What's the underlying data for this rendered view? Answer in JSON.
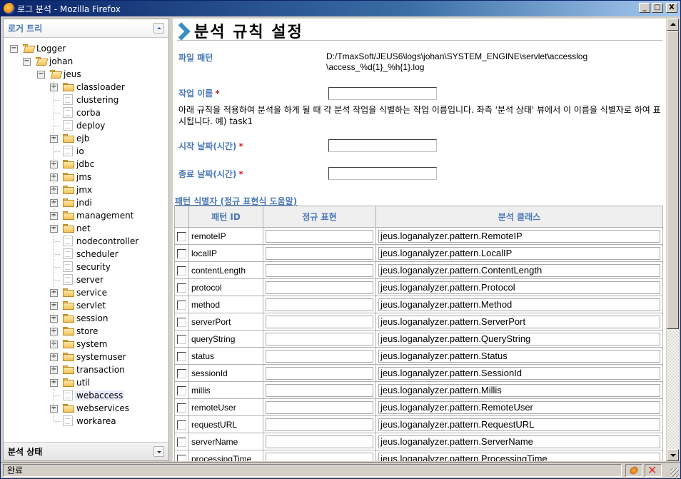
{
  "window": {
    "title": "로그 분석 - Mozilla Firefox",
    "buttons": {
      "minimize": "_",
      "maximize": "□",
      "close": "X"
    }
  },
  "sidebar": {
    "header": "로거 트리",
    "footer": "분석 상태",
    "tree": [
      {
        "label": "Logger",
        "type": "folder-open",
        "level": 0,
        "expander": "minus"
      },
      {
        "label": "johan",
        "type": "folder-open",
        "level": 1,
        "expander": "minus"
      },
      {
        "label": "jeus",
        "type": "folder-open",
        "level": 2,
        "expander": "minus"
      },
      {
        "label": "classloader",
        "type": "folder",
        "level": 3,
        "expander": "plus"
      },
      {
        "label": "clustering",
        "type": "doc",
        "level": 3
      },
      {
        "label": "corba",
        "type": "doc",
        "level": 3
      },
      {
        "label": "deploy",
        "type": "doc",
        "level": 3
      },
      {
        "label": "ejb",
        "type": "folder",
        "level": 3,
        "expander": "plus"
      },
      {
        "label": "io",
        "type": "doc",
        "level": 3
      },
      {
        "label": "jdbc",
        "type": "folder",
        "level": 3,
        "expander": "plus"
      },
      {
        "label": "jms",
        "type": "folder",
        "level": 3,
        "expander": "plus"
      },
      {
        "label": "jmx",
        "type": "folder",
        "level": 3,
        "expander": "plus"
      },
      {
        "label": "jndi",
        "type": "folder",
        "level": 3,
        "expander": "plus"
      },
      {
        "label": "management",
        "type": "folder",
        "level": 3,
        "expander": "plus"
      },
      {
        "label": "net",
        "type": "folder",
        "level": 3,
        "expander": "plus"
      },
      {
        "label": "nodecontroller",
        "type": "doc",
        "level": 3
      },
      {
        "label": "scheduler",
        "type": "doc",
        "level": 3
      },
      {
        "label": "security",
        "type": "doc",
        "level": 3
      },
      {
        "label": "server",
        "type": "doc",
        "level": 3
      },
      {
        "label": "service",
        "type": "folder",
        "level": 3,
        "expander": "plus"
      },
      {
        "label": "servlet",
        "type": "folder",
        "level": 3,
        "expander": "plus"
      },
      {
        "label": "session",
        "type": "folder",
        "level": 3,
        "expander": "plus"
      },
      {
        "label": "store",
        "type": "folder",
        "level": 3,
        "expander": "plus"
      },
      {
        "label": "system",
        "type": "folder",
        "level": 3,
        "expander": "plus"
      },
      {
        "label": "systemuser",
        "type": "folder",
        "level": 3,
        "expander": "plus"
      },
      {
        "label": "transaction",
        "type": "folder",
        "level": 3,
        "expander": "plus"
      },
      {
        "label": "util",
        "type": "folder",
        "level": 3,
        "expander": "plus"
      },
      {
        "label": "webaccess",
        "type": "doc",
        "level": 3,
        "selected": true
      },
      {
        "label": "webservices",
        "type": "folder",
        "level": 3,
        "expander": "plus"
      },
      {
        "label": "workarea",
        "type": "doc",
        "level": 3
      }
    ]
  },
  "main": {
    "title": "분석 규칙 설정",
    "file_pattern_label": "파일 패턴",
    "file_pattern_line1": "D:/TmaxSoft/JEUS6\\logs\\johan\\SYSTEM_ENGINE\\servlet\\accesslog",
    "file_pattern_line2": "\\access_%d{1}_%h{1}.log",
    "task_name_label": "작업 이름",
    "required_mark": "*",
    "task_name_value": "",
    "task_desc": "아래 규칙을 적용하여 분석을 하게 될 때 각 분석 작업을 식별하는 작업 이름입니다. 좌측 '분석 상태' 뷰에서 이 이름을 식별자로 하여 표시됩니다. 예) task1",
    "start_label": "시작 날짜(시간)",
    "start_value": "",
    "end_label": "종료 날짜(시간)",
    "end_value": "",
    "pattern_section": "패턴 식별자 (정규 표현식 도움말)",
    "table": {
      "headers": [
        "",
        "패턴 ID",
        "정규 표현",
        "분석 클래스"
      ],
      "rows": [
        {
          "id": "remoteIP",
          "regex": "",
          "cls": "jeus.loganalyzer.pattern.RemoteIP",
          "checked": false
        },
        {
          "id": "localIP",
          "regex": "",
          "cls": "jeus.loganalyzer.pattern.LocalIP",
          "checked": false
        },
        {
          "id": "contentLength",
          "regex": "",
          "cls": "jeus.loganalyzer.pattern.ContentLength",
          "checked": false
        },
        {
          "id": "protocol",
          "regex": "",
          "cls": "jeus.loganalyzer.pattern.Protocol",
          "checked": false
        },
        {
          "id": "method",
          "regex": "",
          "cls": "jeus.loganalyzer.pattern.Method",
          "checked": false
        },
        {
          "id": "serverPort",
          "regex": "",
          "cls": "jeus.loganalyzer.pattern.ServerPort",
          "checked": false
        },
        {
          "id": "queryString",
          "regex": "",
          "cls": "jeus.loganalyzer.pattern.QueryString",
          "checked": false
        },
        {
          "id": "status",
          "regex": "",
          "cls": "jeus.loganalyzer.pattern.Status",
          "checked": false
        },
        {
          "id": "sessionId",
          "regex": "",
          "cls": "jeus.loganalyzer.pattern.SessionId",
          "checked": false
        },
        {
          "id": "millis",
          "regex": "",
          "cls": "jeus.loganalyzer.pattern.Millis",
          "checked": false
        },
        {
          "id": "remoteUser",
          "regex": "",
          "cls": "jeus.loganalyzer.pattern.RemoteUser",
          "checked": false
        },
        {
          "id": "requestURL",
          "regex": "",
          "cls": "jeus.loganalyzer.pattern.RequestURL",
          "checked": false
        },
        {
          "id": "serverName",
          "regex": "",
          "cls": "jeus.loganalyzer.pattern.ServerName",
          "checked": false
        },
        {
          "id": "processingTime",
          "regex": "",
          "cls": "jeus.loganalyzer.pattern.ProcessingTime",
          "checked": false
        }
      ]
    }
  },
  "statusbar": {
    "text": "완료",
    "icons": [
      "bug-icon",
      "stop-icon"
    ]
  },
  "colors": {
    "label_blue": "#4a78b8",
    "required_red": "#d02020",
    "chevron": "#3a8ec0"
  }
}
